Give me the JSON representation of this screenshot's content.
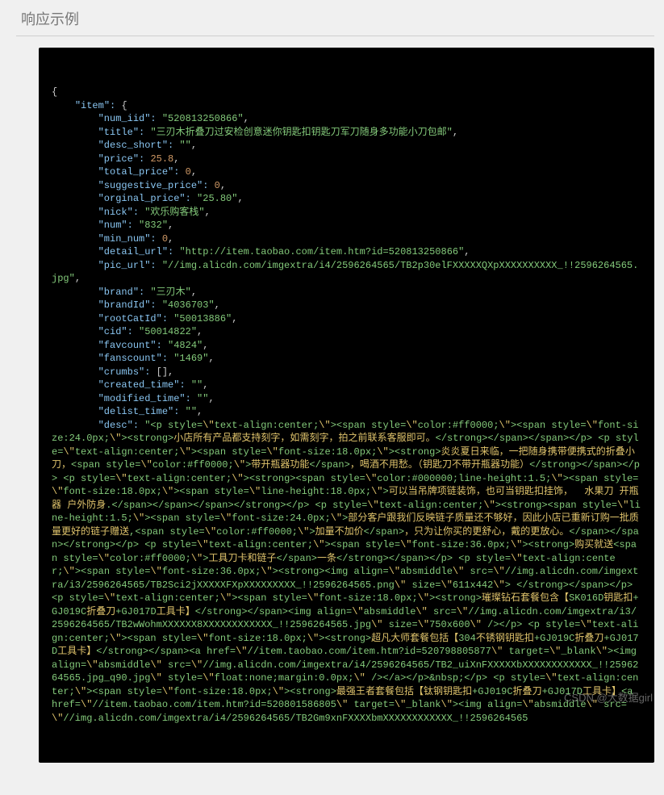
{
  "heading": "响应示例",
  "watermark": "CSDN @大数据girl",
  "json_data": {
    "item": {
      "num_iid": "520813250866",
      "title": "三刃木折叠刀过安检创意迷你钥匙扣钥匙刀军刀随身多功能小刀包邮",
      "desc_short": "",
      "price": 25.8,
      "total_price": 0,
      "suggestive_price": 0,
      "orginal_price": "25.80",
      "nick": "欢乐购客栈",
      "num": "832",
      "min_num": 0,
      "detail_url": "http://item.taobao.com/item.htm?id=520813250866",
      "pic_url": "//img.alicdn.com/imgextra/i4/2596264565/TB2p30elFXXXXXQXpXXXXXXXXXX_!!2596264565.jpg",
      "brand": "三刃木",
      "brandId": "4036703",
      "rootCatId": "50013886",
      "cid": "50014822",
      "favcount": "4824",
      "fanscount": "1469",
      "crumbs": [],
      "created_time": "",
      "modified_time": "",
      "delist_time": "",
      "desc": "<p style=\\\"text-align:center;\\\"><span style=\\\"color:#ff0000;\\\"><span style=\\\"font-size:24.0px;\\\"><strong>小店所有产品都支持刻字，如需刻字，拍之前联系客服即可。</strong></span></span></p> <p style=\\\"text-align:center;\\\"><span style=\\\"font-size:18.0px;\\\"><strong>炎炎夏日来临，一把随身携带便携式的折叠小刀，<span style=\\\"color:#ff0000;\\\">带开瓶器功能</span>，喝酒不用愁。（钥匙刀不带开瓶器功能）</strong></span></p> <p style=\\\"text-align:center;\\\"><strong><span style=\\\"color:#000000;line-height:1.5;\\\"><span style=\\\"font-size:18.0px;\\\"><span style=\\\"line-height:18.0px;\\\">可以当吊牌项链装饰，也可当钥匙扣挂饰，  水果刀 开瓶器 户外防身.</span></span></span></strong></p> <p style=\\\"text-align:center;\\\"><strong><span style=\\\"line-height:1.5;\\\"><span style=\\\"font-size:24.0px;\\\">部分客户跟我们反映链子质量还不够好，因此小店已重新订购一批质量更好的链子赠送,<span style=\\\"color:#ff0000;\\\">加量不加价</span>，只为让你买的更舒心，戴的更放心。</span></span></strong></p> <p style=\\\"text-align:center;\\\"><span style=\\\"font-size:36.0px;\\\"><strong>购买就送<span style=\\\"color:#ff0000;\\\">工具刀卡和链子</span>一条</strong></span></p> <p style=\\\"text-align:center;\\\"><span style=\\\"font-size:36.0px;\\\"><strong><img align=\\\"absmiddle\\\" src=\\\"//img.alicdn.com/imgextra/i3/2596264565/TB2Sci2jXXXXXFXpXXXXXXXXX_!!2596264565.png\\\" size=\\\"611x442\\\"> </strong></span></p> <p style=\\\"text-align:center;\\\"><span style=\\\"font-size:18.0px;\\\"><strong>璀璨钻石套餐包含【SK016D钥匙扣+GJ019C折叠刀+GJ017D工具卡】</strong></span><img align=\\\"absmiddle\\\" src=\\\"//img.alicdn.com/imgextra/i3/2596264565/TB2wWohmXXXXXX8XXXXXXXXXXXX_!!2596264565.jpg\\\" size=\\\"750x600\\\" /></p> <p style=\\\"text-align:center;\\\"><span style=\\\"font-size:18.0px;\\\"><strong>超凡大师套餐包括【304不锈钢钥匙扣+GJ019C折叠刀+GJ017D工具卡】</strong></span><a href=\\\"//item.taobao.com/item.htm?id=520798805877\\\" target=\\\"_blank\\\"><img align=\\\"absmiddle\\\" src=\\\"//img.alicdn.com/imgextra/i4/2596264565/TB2_uiXnFXXXXXbXXXXXXXXXXXX_!!2596264565.jpg_q90.jpg\\\" style=\\\"float:none;margin:0.0px;\\\" /></a></p>&nbsp;</p> <p style=\\\"text-align:center;\\\"><span style=\\\"font-size:18.0px;\\\"><strong>最强王者套餐包括【钛钢钥匙扣+GJ019C折叠刀+GJ017D工具卡】<a href=\\\"//item.taobao.com/item.htm?id=520801586805\\\" target=\\\"_blank\\\"><img align=\\\"absmiddle\\\" src=\\\"//img.alicdn.com/imgextra/i4/2596264565/TB2Gm9xnFXXXXbmXXXXXXXXXXXX_!!2596264565"
    }
  }
}
